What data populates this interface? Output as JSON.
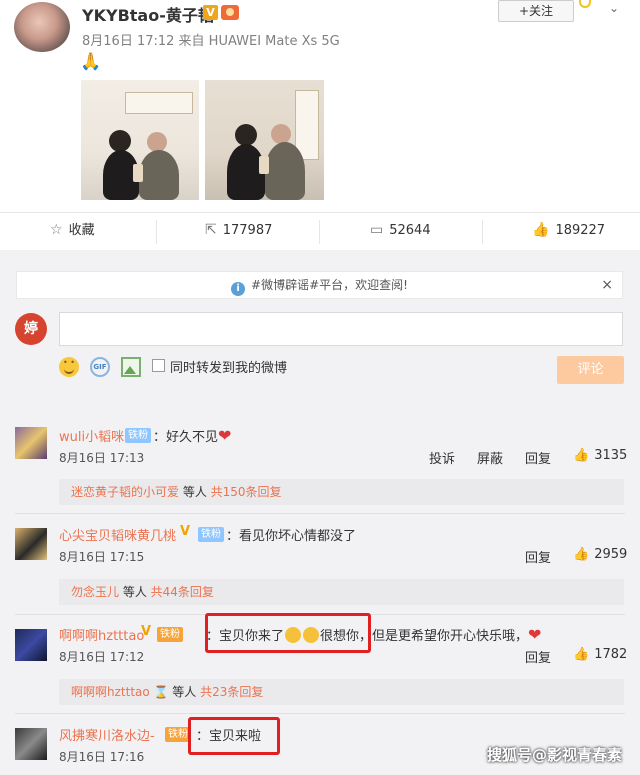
{
  "post": {
    "author": "YKYBtao-黄子韬",
    "follow_label": "+关注",
    "meta": "8月16日 17:12 来自 HUAWEI Mate Xs 5G",
    "text_emoji": "🙏"
  },
  "actions": {
    "favorite_label": "收藏",
    "repost_count": "177987",
    "comment_count": "52644",
    "like_count": "189227"
  },
  "comment_panel": {
    "notice": "#微博辟谣#平台，欢迎查阅!",
    "close_icon": "×",
    "my_avatar_text": "婷",
    "sync_label": "同时转发到我的微博",
    "submit_label": "评论"
  },
  "comments": [
    {
      "name": "wuli小韬咪",
      "badge": "铁粉",
      "text": "：好久不见",
      "time": "8月16日 17:13",
      "report": "投诉",
      "block": "屏蔽",
      "reply": "回复",
      "likes": "3135",
      "reply_preview_name": "迷恋黄子韬的小可爱",
      "reply_preview_tail": " 等人 ",
      "reply_preview_count": "共150条回复"
    },
    {
      "name": "心尖宝贝韬咪黄几桃",
      "badge": "铁粉",
      "text": "：看见你坏心情都没了",
      "time": "8月16日 17:15",
      "reply": "回复",
      "likes": "2959",
      "reply_preview_name": "勿念玉儿",
      "reply_preview_tail": " 等人 ",
      "reply_preview_count": "共44条回复"
    },
    {
      "name": "啊啊啊hztttao",
      "badge": "铁粉",
      "text_a": "：宝贝你来了",
      "text_b": "很想你，",
      "text_c": "但是更希望你开心快乐哦，",
      "time": "8月16日 17:12",
      "reply": "回复",
      "likes": "1782",
      "reply_preview_name": "啊啊啊hztttao",
      "reply_preview_tail": " 等人 ",
      "reply_preview_count": "共23条回复"
    },
    {
      "name": "风拂寒川洛水边-",
      "badge": "铁粉",
      "text": "：宝贝来啦",
      "time": "8月16日 17:16"
    }
  ],
  "watermark": "搜狐号@影视青春素"
}
